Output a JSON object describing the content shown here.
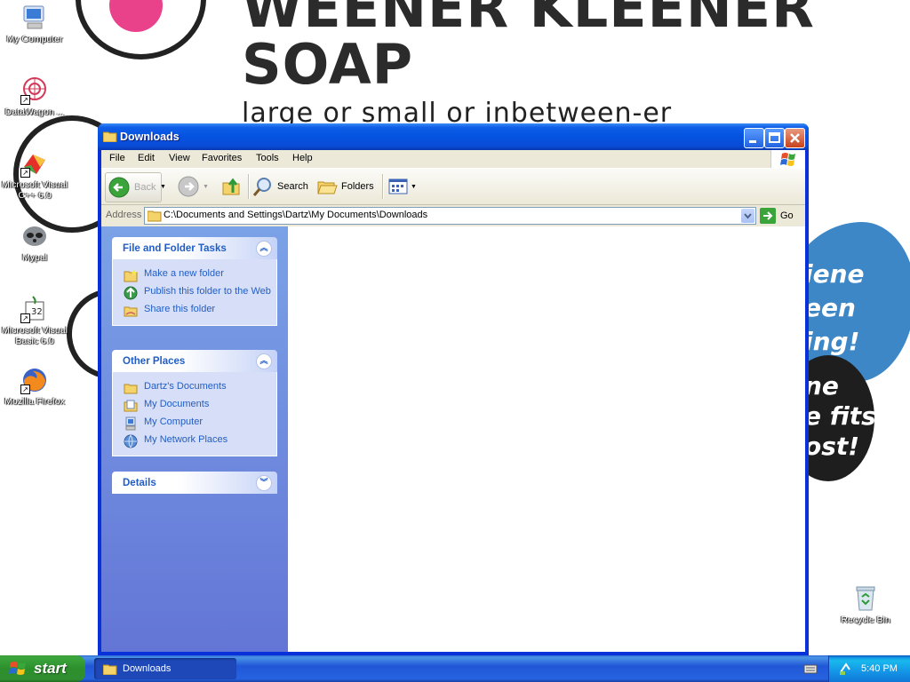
{
  "wallpaper": {
    "headline1": "WEENER KLEENER",
    "headline2": "SOAP",
    "tagline": "large or small or inbetween-er",
    "side_text": [
      "iene",
      "een",
      "ing!",
      "ne",
      "e fits",
      "ost!"
    ]
  },
  "desktop_icons": [
    {
      "label": "My Computer",
      "icon": "my-computer-icon"
    },
    {
      "label": "DataWagon ...",
      "icon": "datawagon-icon"
    },
    {
      "label": "Microsoft Visual C++ 6.0",
      "icon": "visual-cpp-icon"
    },
    {
      "label": "Mypal",
      "icon": "mypal-icon"
    },
    {
      "label": "Microsoft Visual Basic 6.0",
      "icon": "visual-basic-icon"
    },
    {
      "label": "Mozilla Firefox",
      "icon": "firefox-icon"
    },
    {
      "label": "Recycle Bin",
      "icon": "recycle-bin-icon"
    }
  ],
  "window": {
    "title": "Downloads",
    "menu": [
      "File",
      "Edit",
      "View",
      "Favorites",
      "Tools",
      "Help"
    ],
    "toolbar": {
      "back": "Back",
      "search": "Search",
      "folders": "Folders"
    },
    "address": {
      "label": "Address",
      "path": "C:\\Documents and Settings\\Dartz\\My Documents\\Downloads",
      "go": "Go"
    },
    "task_panels": [
      {
        "title": "File and Folder Tasks",
        "items": [
          {
            "label": "Make a new folder",
            "icon": "new-folder-icon"
          },
          {
            "label": "Publish this folder to the Web",
            "icon": "publish-web-icon"
          },
          {
            "label": "Share this folder",
            "icon": "share-folder-icon"
          }
        ]
      },
      {
        "title": "Other Places",
        "items": [
          {
            "label": "Dartz's Documents",
            "icon": "folder-icon"
          },
          {
            "label": "My Documents",
            "icon": "my-documents-icon"
          },
          {
            "label": "My Computer",
            "icon": "my-computer-icon"
          },
          {
            "label": "My Network Places",
            "icon": "network-places-icon"
          }
        ]
      },
      {
        "title": "Details",
        "items": []
      }
    ]
  },
  "taskbar": {
    "start": "start",
    "tasks": [
      "Downloads"
    ],
    "clock": "5:40 PM"
  },
  "colors": {
    "title_blue": "#0453e0",
    "taskpane_link": "#215dc6",
    "start_green": "#3ba53b",
    "taskbar_blue": "#2157d7"
  }
}
